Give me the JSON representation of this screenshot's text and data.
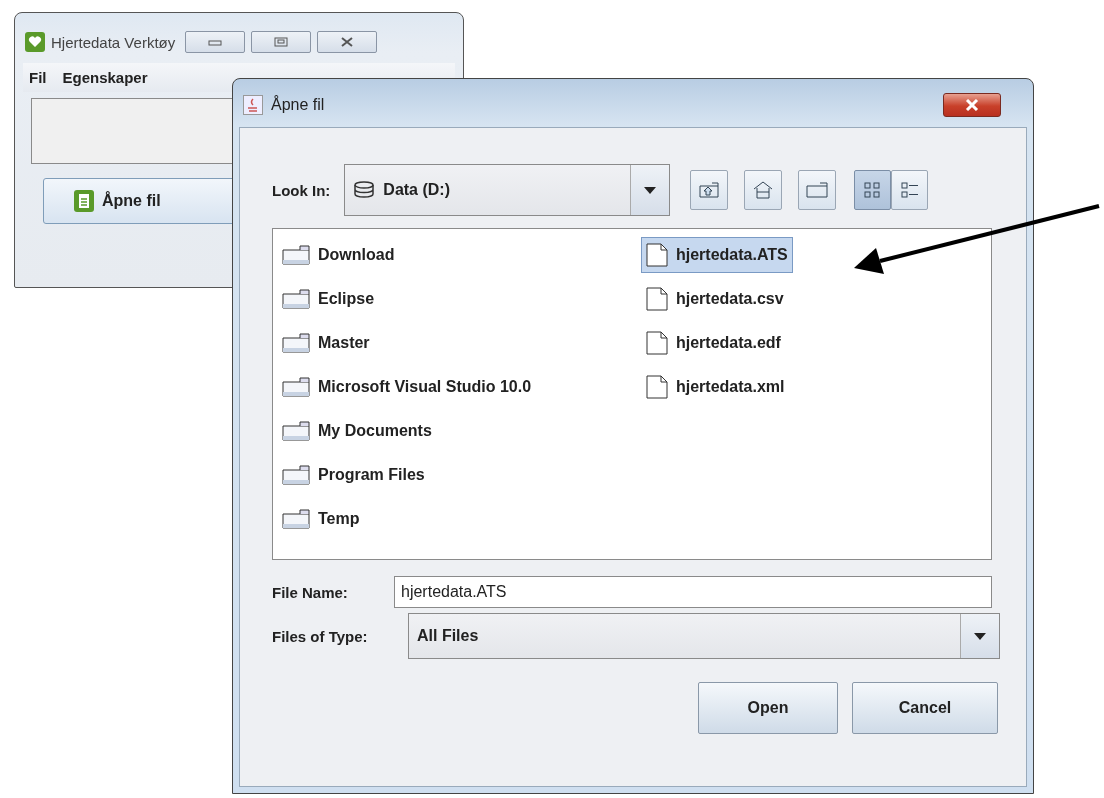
{
  "main_window": {
    "title": "Hjertedata Verktøy",
    "menu": [
      "Fil",
      "Egenskaper"
    ],
    "open_button": "Åpne fil"
  },
  "dialog": {
    "title": "Åpne fil",
    "look_in": {
      "label": "Look In:",
      "value": "Data (D:)"
    },
    "view_modes": [
      {
        "kind": "list",
        "selected": true
      },
      {
        "kind": "details",
        "selected": false
      }
    ],
    "items": [
      {
        "name": "Download",
        "kind": "folder",
        "selected": false
      },
      {
        "name": "Eclipse",
        "kind": "folder",
        "selected": false
      },
      {
        "name": "Master",
        "kind": "folder",
        "selected": false
      },
      {
        "name": "Microsoft Visual Studio 10.0",
        "kind": "folder",
        "selected": false
      },
      {
        "name": "My Documents",
        "kind": "folder",
        "selected": false
      },
      {
        "name": "Program Files",
        "kind": "folder",
        "selected": false
      },
      {
        "name": "Temp",
        "kind": "folder",
        "selected": false
      },
      {
        "name": "hjertedata.ATS",
        "kind": "file",
        "selected": true
      },
      {
        "name": "hjertedata.csv",
        "kind": "file",
        "selected": false
      },
      {
        "name": "hjertedata.edf",
        "kind": "file",
        "selected": false
      },
      {
        "name": "hjertedata.xml",
        "kind": "file",
        "selected": false
      }
    ],
    "file_name": {
      "label": "File Name:",
      "value": "hjertedata.ATS"
    },
    "file_type": {
      "label": "Files of Type:",
      "value": "All Files"
    },
    "buttons": [
      "Open",
      "Cancel"
    ]
  }
}
